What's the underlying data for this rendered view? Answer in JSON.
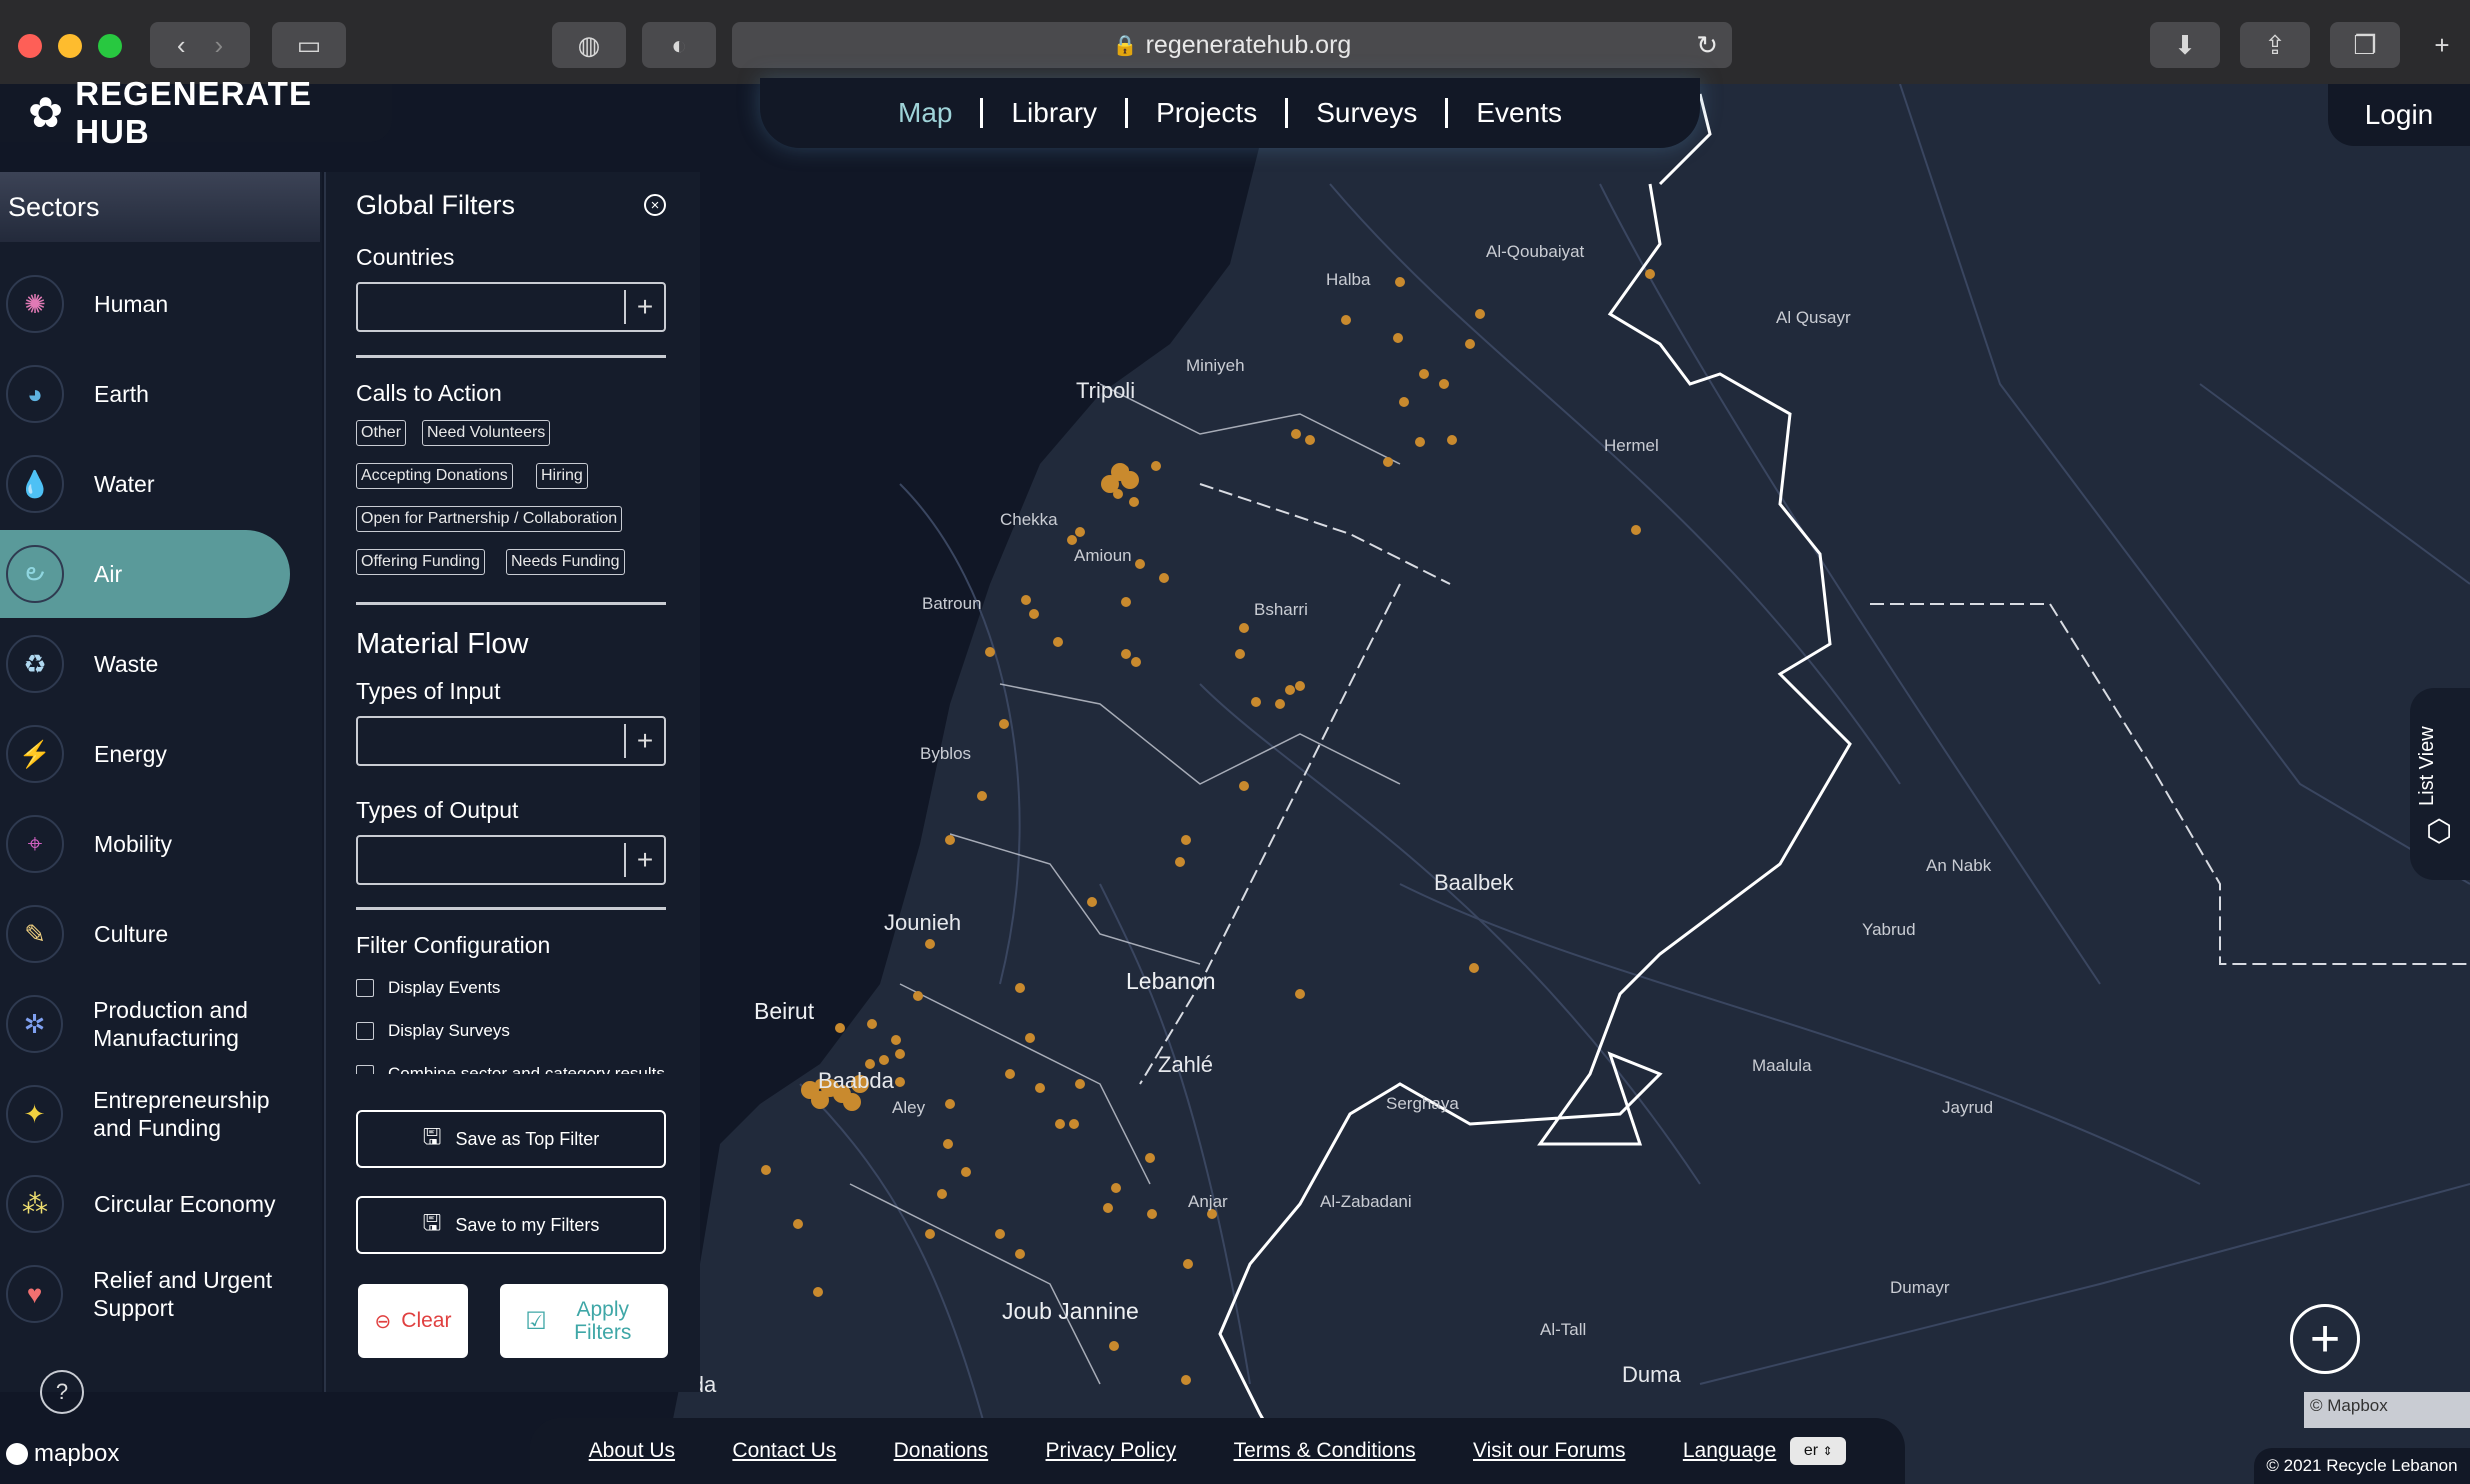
{
  "browser": {
    "url": "regeneratehub.org",
    "traffic_lights": [
      "#fe5f57",
      "#febc2e",
      "#28c840"
    ]
  },
  "site": {
    "logo_text": "REGENERATE HUB",
    "nav": [
      "Map",
      "Library",
      "Projects",
      "Surveys",
      "Events"
    ],
    "active_nav": "Map",
    "login": "Login"
  },
  "sectors": {
    "title": "Sectors",
    "items": [
      {
        "label": "Human",
        "icon": "human-icon",
        "color": "#e07ab5"
      },
      {
        "label": "Earth",
        "icon": "earth-icon",
        "color": "#5fb3e0"
      },
      {
        "label": "Water",
        "icon": "water-drop-icon",
        "color": "#7fd0f0"
      },
      {
        "label": "Air",
        "icon": "air-swirl-icon",
        "color": "#8fd6e0"
      },
      {
        "label": "Waste",
        "icon": "waste-bottle-icon",
        "color": "#b0d8f0"
      },
      {
        "label": "Energy",
        "icon": "lightning-icon",
        "color": "#f0a040"
      },
      {
        "label": "Mobility",
        "icon": "compass-icon",
        "color": "#d060c0"
      },
      {
        "label": "Culture",
        "icon": "book-icon",
        "color": "#f0d080"
      },
      {
        "label": "Production and Manufacturing",
        "icon": "gears-icon",
        "color": "#7fa0f0"
      },
      {
        "label": "Entrepreneurship and Funding",
        "icon": "lightbulb-icon",
        "color": "#f0d040"
      },
      {
        "label": "Circular Economy",
        "icon": "circular-dots-icon",
        "color": "#f0e070"
      },
      {
        "label": "Relief and Urgent Support",
        "icon": "heart-hands-icon",
        "color": "#f07070"
      }
    ],
    "active": "Air",
    "help_icon": "help-icon"
  },
  "filters": {
    "title": "Global Filters",
    "countries_label": "Countries",
    "calls_label": "Calls to Action",
    "tags": [
      "Other",
      "Need Volunteers",
      "Accepting Donations",
      "Hiring",
      "Open for Partnership / Collaboration",
      "Offering Funding",
      "Needs Funding"
    ],
    "material_flow": "Material Flow",
    "input_label": "Types of Input",
    "output_label": "Types of Output",
    "config_label": "Filter Configuration",
    "options": [
      "Display Events",
      "Display Surveys",
      "Combine sector and category results"
    ],
    "save_top": "Save as Top Filter",
    "save_mine": "Save to my Filters",
    "clear": "Clear",
    "apply": "Apply Filters"
  },
  "map": {
    "labels": {
      "al_qoubaiyat": "Al-Qoubaiyat",
      "halba": "Halba",
      "al_qusayr": "Al Qusayr",
      "miniyeh": "Miniyeh",
      "tripoli": "Tripoli",
      "hermel": "Hermel",
      "chekka": "Chekka",
      "amioun": "Amioun",
      "batroun": "Batroun",
      "bsharri": "Bsharri",
      "byblos": "Byblos",
      "baalbek": "Baalbek",
      "an_nabk": "An Nabk",
      "yabrud": "Yabrud",
      "jounieh": "Jounieh",
      "lebanon": "Lebanon",
      "beirut": "Beirut",
      "zahle": "Zahlé",
      "maalula": "Maalula",
      "baabda": "Baabda",
      "aley": "Aley",
      "serghaya": "Serghaya",
      "jayrud": "Jayrud",
      "anjar": "Anjar",
      "al_zabadani": "Al-Zabadani",
      "dumayr": "Dumayr",
      "joub_jannine": "Joub Jannine",
      "al_tall": "Al-Tall",
      "duma": "Duma",
      "saida": "Saida"
    },
    "marker_color": "#c98a2e",
    "list_view": "List View",
    "attribution": "© Mapbox",
    "mapbox_logo": "mapbox"
  },
  "footer": {
    "links": [
      "About Us",
      "Contact Us",
      "Donations",
      "Privacy Policy",
      "Terms & Conditions",
      "Visit our Forums"
    ],
    "language_label": "Language",
    "language_value": "er",
    "copyright": "© 2021 Recycle Lebanon"
  }
}
